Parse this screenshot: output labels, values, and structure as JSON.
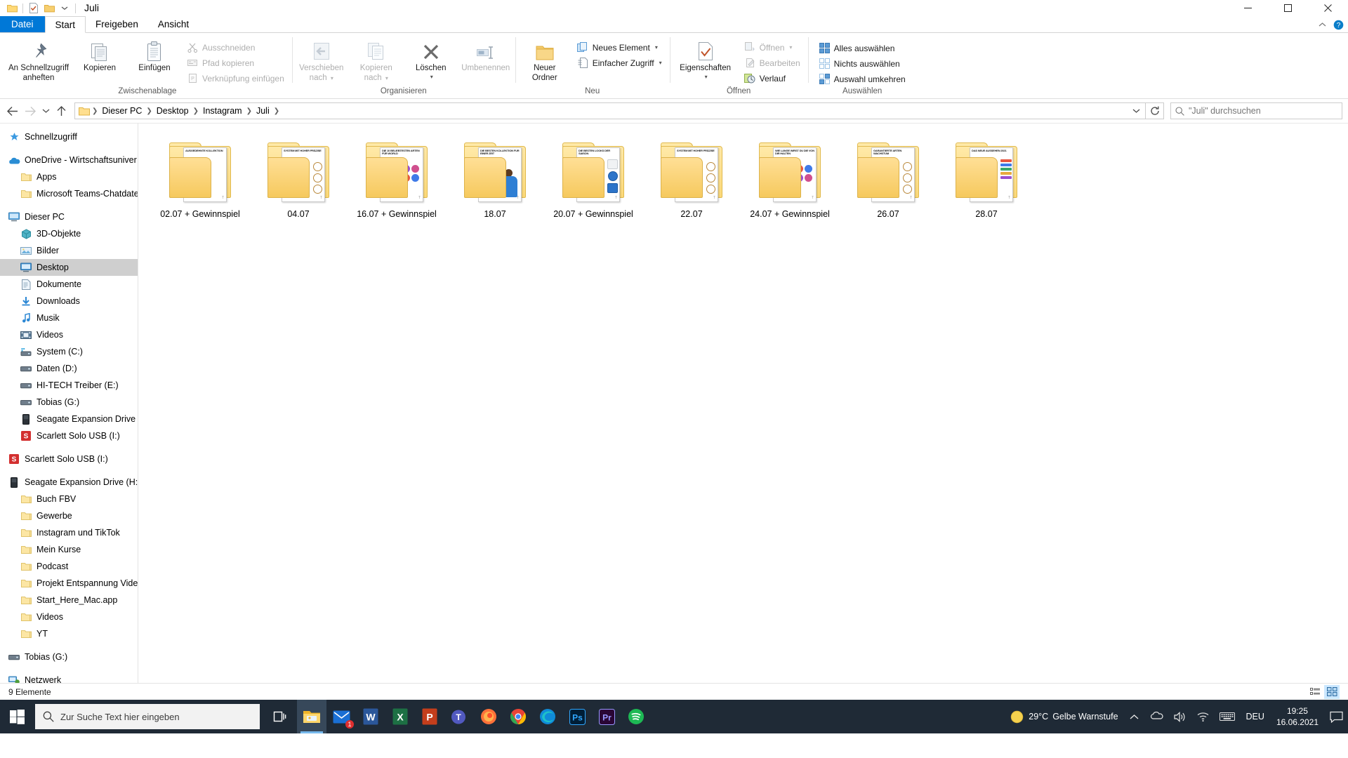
{
  "window": {
    "title": "Juli",
    "quick_access": [
      "folder-icon",
      "properties-icon",
      "new-folder-icon",
      "dropdown-icon"
    ],
    "controls": {
      "minimize": "minimize-icon",
      "maximize": "maximize-icon",
      "close": "close-icon"
    }
  },
  "ribbon": {
    "tabs": [
      {
        "label": "Datei",
        "active": false,
        "is_file": true
      },
      {
        "label": "Start",
        "active": true,
        "is_file": false
      },
      {
        "label": "Freigeben",
        "active": false,
        "is_file": false
      },
      {
        "label": "Ansicht",
        "active": false,
        "is_file": false
      }
    ],
    "help_icon": "help-icon",
    "collapse_icon": "chevron-up-icon",
    "groups": [
      {
        "label": "Zwischenablage",
        "big": [
          {
            "label": "An Schnellzugriff\nanheften",
            "icon": "pin-icon",
            "disabled": false
          },
          {
            "label": "Kopieren",
            "icon": "copy-icon",
            "disabled": false
          },
          {
            "label": "Einfügen",
            "icon": "paste-icon",
            "disabled": false
          }
        ],
        "small": [
          {
            "label": "Ausschneiden",
            "icon": "scissors-icon",
            "disabled": true
          },
          {
            "label": "Pfad kopieren",
            "icon": "copy-path-icon",
            "disabled": true
          },
          {
            "label": "Verknüpfung einfügen",
            "icon": "paste-shortcut-icon",
            "disabled": true
          }
        ]
      },
      {
        "label": "Organisieren",
        "big": [
          {
            "label": "Verschieben\nnach",
            "icon": "move-to-icon",
            "disabled": true,
            "caret": true
          },
          {
            "label": "Kopieren\nnach",
            "icon": "copy-to-icon",
            "disabled": true,
            "caret": true
          },
          {
            "label": "Löschen",
            "icon": "delete-icon",
            "disabled": false,
            "caret": true
          },
          {
            "label": "Umbenennen",
            "icon": "rename-icon",
            "disabled": true
          }
        ],
        "small": []
      },
      {
        "label": "Neu",
        "big": [
          {
            "label": "Neuer\nOrdner",
            "icon": "new-folder-icon",
            "disabled": false
          }
        ],
        "small": [
          {
            "label": "Neues Element",
            "icon": "new-item-icon",
            "disabled": false,
            "caret": true
          },
          {
            "label": "Einfacher Zugriff",
            "icon": "easy-access-icon",
            "disabled": false,
            "caret": true
          }
        ]
      },
      {
        "label": "Öffnen",
        "big": [
          {
            "label": "Eigenschaften",
            "icon": "properties-icon",
            "disabled": false,
            "caret": true
          }
        ],
        "small": [
          {
            "label": "Öffnen",
            "icon": "open-icon",
            "disabled": true,
            "caret": true
          },
          {
            "label": "Bearbeiten",
            "icon": "edit-icon",
            "disabled": true
          },
          {
            "label": "Verlauf",
            "icon": "history-icon",
            "disabled": false
          }
        ]
      },
      {
        "label": "Auswählen",
        "big": [],
        "small": [
          {
            "label": "Alles auswählen",
            "icon": "select-all-icon",
            "disabled": false
          },
          {
            "label": "Nichts auswählen",
            "icon": "select-none-icon",
            "disabled": false
          },
          {
            "label": "Auswahl umkehren",
            "icon": "invert-selection-icon",
            "disabled": false
          }
        ]
      }
    ]
  },
  "addressbar": {
    "back_icon": "back-arrow-icon",
    "forward_icon": "forward-arrow-icon",
    "recent_icon": "recent-locations-icon",
    "up_icon": "up-arrow-icon",
    "breadcrumb": [
      "Dieser PC",
      "Desktop",
      "Instagram",
      "Juli"
    ],
    "dropdown_icon": "chevron-down-icon",
    "refresh_icon": "refresh-icon",
    "search_placeholder": "\"Juli\" durchsuchen",
    "search_icon": "search-icon"
  },
  "sidebar": {
    "items": [
      {
        "label": "Schnellzugriff",
        "icon": "star-pin-icon",
        "indent": 0,
        "selected": false,
        "gap_before": false
      },
      {
        "label": "OneDrive - Wirtschaftsuniver",
        "icon": "onedrive-icon",
        "indent": 0,
        "selected": false,
        "gap_before": true
      },
      {
        "label": "Apps",
        "icon": "folder-icon",
        "indent": 1,
        "selected": false,
        "gap_before": false
      },
      {
        "label": "Microsoft Teams-Chatdatei",
        "icon": "folder-icon",
        "indent": 1,
        "selected": false,
        "gap_before": false
      },
      {
        "label": "Dieser PC",
        "icon": "pc-icon",
        "indent": 0,
        "selected": false,
        "gap_before": true
      },
      {
        "label": "3D-Objekte",
        "icon": "objects3d-icon",
        "indent": 1,
        "selected": false,
        "gap_before": false
      },
      {
        "label": "Bilder",
        "icon": "pictures-icon",
        "indent": 1,
        "selected": false,
        "gap_before": false
      },
      {
        "label": "Desktop",
        "icon": "desktop-icon",
        "indent": 1,
        "selected": true,
        "gap_before": false
      },
      {
        "label": "Dokumente",
        "icon": "documents-icon",
        "indent": 1,
        "selected": false,
        "gap_before": false
      },
      {
        "label": "Downloads",
        "icon": "downloads-icon",
        "indent": 1,
        "selected": false,
        "gap_before": false
      },
      {
        "label": "Musik",
        "icon": "music-icon",
        "indent": 1,
        "selected": false,
        "gap_before": false
      },
      {
        "label": "Videos",
        "icon": "videos-icon",
        "indent": 1,
        "selected": false,
        "gap_before": false
      },
      {
        "label": "System (C:)",
        "icon": "system-drive-icon",
        "indent": 1,
        "selected": false,
        "gap_before": false
      },
      {
        "label": "Daten (D:)",
        "icon": "drive-icon",
        "indent": 1,
        "selected": false,
        "gap_before": false
      },
      {
        "label": "HI-TECH Treiber (E:)",
        "icon": "drive-icon",
        "indent": 1,
        "selected": false,
        "gap_before": false
      },
      {
        "label": "Tobias (G:)",
        "icon": "drive-icon",
        "indent": 1,
        "selected": false,
        "gap_before": false
      },
      {
        "label": "Seagate Expansion Drive (H",
        "icon": "external-drive-icon",
        "indent": 1,
        "selected": false,
        "gap_before": false
      },
      {
        "label": "Scarlett Solo USB (I:)",
        "icon": "scarlett-icon",
        "indent": 1,
        "selected": false,
        "gap_before": false
      },
      {
        "label": "Scarlett Solo USB (I:)",
        "icon": "scarlett-icon",
        "indent": 0,
        "selected": false,
        "gap_before": true
      },
      {
        "label": "Seagate Expansion Drive (H:)",
        "icon": "external-drive-icon",
        "indent": 0,
        "selected": false,
        "gap_before": true
      },
      {
        "label": "Buch FBV",
        "icon": "folder-icon",
        "indent": 1,
        "selected": false,
        "gap_before": false
      },
      {
        "label": "Gewerbe",
        "icon": "folder-icon",
        "indent": 1,
        "selected": false,
        "gap_before": false
      },
      {
        "label": "Instagram und TikTok",
        "icon": "folder-icon",
        "indent": 1,
        "selected": false,
        "gap_before": false
      },
      {
        "label": "Mein Kurse",
        "icon": "folder-icon",
        "indent": 1,
        "selected": false,
        "gap_before": false
      },
      {
        "label": "Podcast",
        "icon": "folder-icon",
        "indent": 1,
        "selected": false,
        "gap_before": false
      },
      {
        "label": "Projekt Entspannung Video",
        "icon": "folder-icon",
        "indent": 1,
        "selected": false,
        "gap_before": false
      },
      {
        "label": "Start_Here_Mac.app",
        "icon": "folder-icon",
        "indent": 1,
        "selected": false,
        "gap_before": false
      },
      {
        "label": "Videos",
        "icon": "folder-icon",
        "indent": 1,
        "selected": false,
        "gap_before": false
      },
      {
        "label": "YT",
        "icon": "folder-icon",
        "indent": 1,
        "selected": false,
        "gap_before": false
      },
      {
        "label": "Tobias (G:)",
        "icon": "drive-icon",
        "indent": 0,
        "selected": false,
        "gap_before": true
      },
      {
        "label": "Netzwerk",
        "icon": "network-icon",
        "indent": 0,
        "selected": false,
        "gap_before": true
      }
    ]
  },
  "content": {
    "folders": [
      {
        "name": "02.07 + Gewinnspiel",
        "thumb_title": "AUSGEDEHNTE KOLLEKTION",
        "thumb_kind": "phone"
      },
      {
        "name": "04.07",
        "thumb_title": "SYSTEM MIT HOHER PRÄZISE",
        "thumb_kind": "phone-badges"
      },
      {
        "name": "16.07 + Gewinnspiel",
        "thumb_title": "DIE 10 BELIEBTESTEN ARTEN FÜR WORLD",
        "thumb_kind": "chips"
      },
      {
        "name": "18.07",
        "thumb_title": "DIE BESTEN KOLLEKTION FÜR EINER ZEIT",
        "thumb_kind": "person"
      },
      {
        "name": "20.07 + Gewinnspiel",
        "thumb_title": "DIE BESTEN LOOKS DER SAISON",
        "thumb_kind": "phone-panel"
      },
      {
        "name": "22.07",
        "thumb_title": "SYSTEM MIT HOHER PRÄZISE",
        "thumb_kind": "phone-badges"
      },
      {
        "name": "24.07 + Gewinnspiel",
        "thumb_title": "WIE LANGE WIRST DU DIE VON DIR HALTEN",
        "thumb_kind": "chips"
      },
      {
        "name": "26.07",
        "thumb_title": "GARANTIERTE ARTEN WACHSTUM",
        "thumb_kind": "phone-badges"
      },
      {
        "name": "28.07",
        "thumb_title": "DAS NEUE AUSSEHEN 2021",
        "thumb_kind": "phone-list"
      }
    ]
  },
  "statusbar": {
    "text": "9 Elemente",
    "views": [
      {
        "icon": "details-view-icon",
        "active": false
      },
      {
        "icon": "large-icons-view-icon",
        "active": true
      }
    ]
  },
  "taskbar": {
    "start_icon": "windows-start-icon",
    "search_placeholder": "Zur Suche Text hier eingeben",
    "search_icon": "search-icon",
    "taskview_icon": "task-view-icon",
    "apps": [
      {
        "name": "file-explorer",
        "icon": "folder-icon",
        "active": true,
        "badge": null
      },
      {
        "name": "mail",
        "icon": "mail-icon",
        "active": false,
        "badge": "1"
      },
      {
        "name": "word",
        "icon": "word-icon",
        "active": false,
        "badge": null
      },
      {
        "name": "excel",
        "icon": "excel-icon",
        "active": false,
        "badge": null
      },
      {
        "name": "powerpoint",
        "icon": "powerpoint-icon",
        "active": false,
        "badge": null
      },
      {
        "name": "teams",
        "icon": "teams-icon",
        "active": false,
        "badge": null
      },
      {
        "name": "firefox",
        "icon": "firefox-icon",
        "active": false,
        "badge": null
      },
      {
        "name": "chrome",
        "icon": "chrome-icon",
        "active": false,
        "badge": null
      },
      {
        "name": "edge",
        "icon": "edge-icon",
        "active": false,
        "badge": null
      },
      {
        "name": "photoshop",
        "icon": "photoshop-icon",
        "active": false,
        "badge": null
      },
      {
        "name": "premiere",
        "icon": "premiere-icon",
        "active": false,
        "badge": null
      },
      {
        "name": "spotify",
        "icon": "spotify-icon",
        "active": false,
        "badge": null
      }
    ],
    "tray": {
      "weather_icon": "sun-icon",
      "weather_temp": "29°C",
      "weather_text": "Gelbe Warnstufe",
      "chevron_icon": "chevron-up-icon",
      "onedrive_icon": "onedrive-tray-icon",
      "volume_icon": "speaker-icon",
      "network_icon": "wifi-icon",
      "keyboard_icon": "keyboard-icon",
      "language": "DEU",
      "time": "19:25",
      "date": "16.06.2021",
      "notifications_icon": "notification-icon"
    }
  }
}
